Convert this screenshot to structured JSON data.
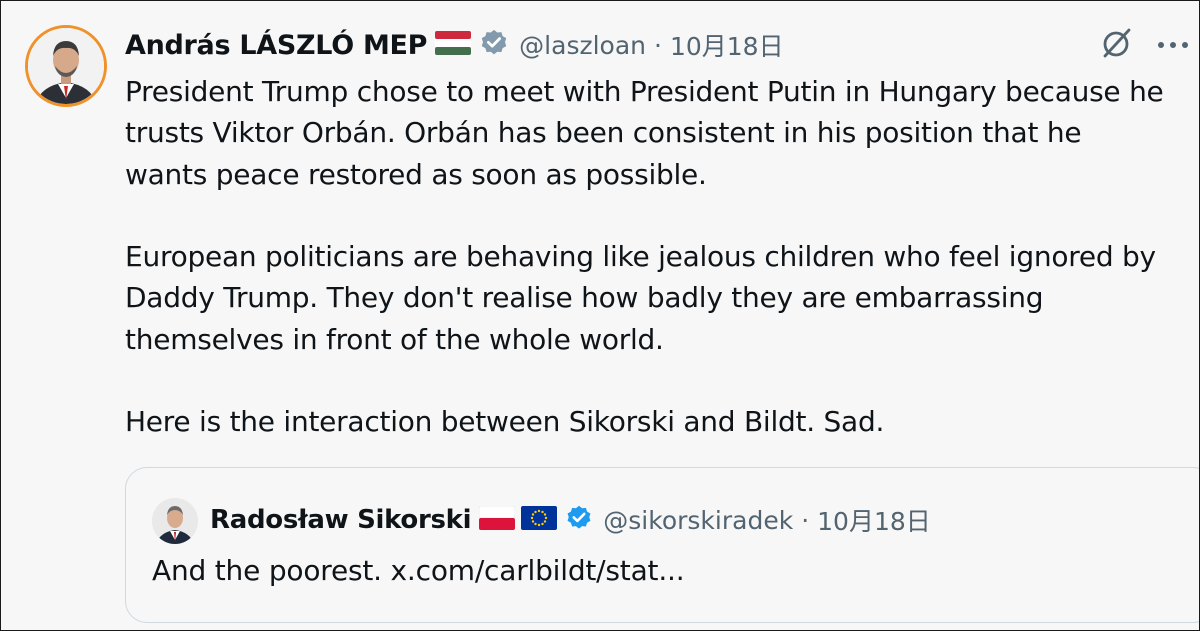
{
  "tweet": {
    "author_name": "András LÁSZLÓ MEP",
    "author_handle": "@laszloan",
    "separator": "·",
    "date": "10月18日",
    "text": "President Trump chose to meet with President Putin in Hungary because he\ntrusts Viktor Orbán. Orbán has been consistent in his position that he\nwants peace restored as soon as possible.\n\nEuropean politicians are behaving like jealous children who feel ignored by\nDaddy Trump. They don't realise how badly they are embarrassing\nthemselves in front of the whole world.\n\nHere is the interaction between Sikorski and Bildt. Sad.",
    "flags": [
      "hungary-flag"
    ],
    "icons": {
      "verified": "verified-badge-icon",
      "grok": "grok-icon",
      "more": "more-icon"
    }
  },
  "quote": {
    "author_name": "Radosław Sikorski",
    "author_handle": "@sikorskiradek",
    "separator": "·",
    "date": "10月18日",
    "text": "And the poorest. x.com/carlbildt/stat...",
    "flags": [
      "poland-flag",
      "eu-flag"
    ]
  },
  "colors": {
    "verified_blue": "#1d9bf0",
    "verified_gray": "#829aab",
    "avatar_ring": "#f0922c",
    "muted_text": "#536471",
    "background": "#f7f7f7"
  }
}
